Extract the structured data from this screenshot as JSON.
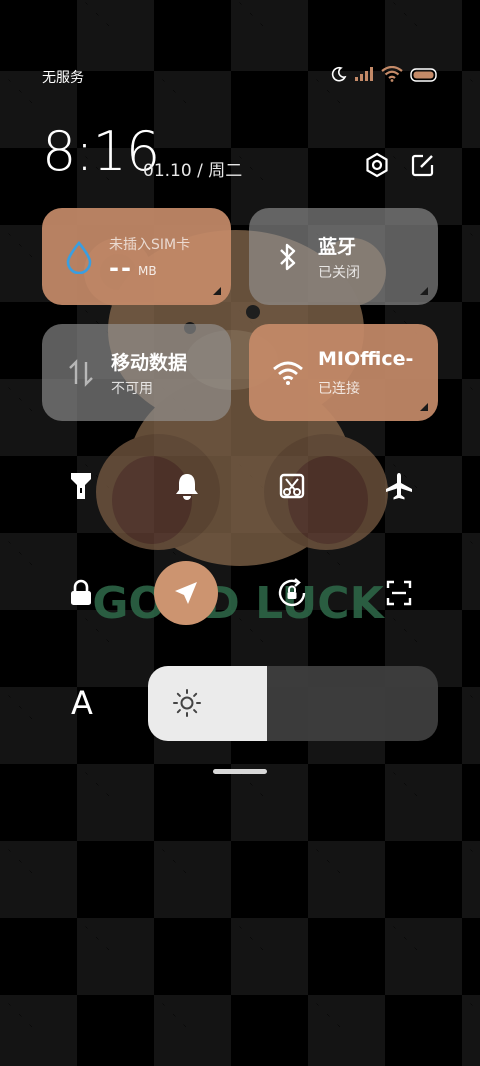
{
  "status_bar": {
    "carrier": "无服务",
    "icons": [
      "moon-icon",
      "signal-icon",
      "wifi-icon",
      "battery-icon"
    ]
  },
  "header": {
    "time": "8:16",
    "date": "01.10 / 周二",
    "buttons": [
      "settings-icon",
      "edit-icon"
    ]
  },
  "tiles": {
    "sim": {
      "label": "未插入SIM卡",
      "value": "--",
      "unit": "MB",
      "icon": "water-drop-icon",
      "active": true
    },
    "bluetooth": {
      "title": "蓝牙",
      "status": "已关闭",
      "icon": "bluetooth-icon",
      "active": false
    },
    "mobile_data": {
      "title": "移动数据",
      "status": "不可用",
      "icon": "data-arrows-icon",
      "active": false
    },
    "wifi": {
      "title": "MIOffice-",
      "status": "已连接",
      "icon": "wifi-icon",
      "active": true
    }
  },
  "toggles": [
    "flashlight-icon",
    "bell-icon",
    "screenshot-icon",
    "airplane-icon",
    "lock-icon",
    "location-icon",
    "rotation-lock-icon",
    "scan-icon"
  ],
  "wallpaper_text": "GOOD LUCK",
  "font_button": "A",
  "brightness": {
    "level": 0.41,
    "icon": "sun-icon"
  },
  "colors": {
    "accent": "#c48a68",
    "inactive_tile": "#8f8f8f",
    "slider_fill": "#ebebeb"
  }
}
